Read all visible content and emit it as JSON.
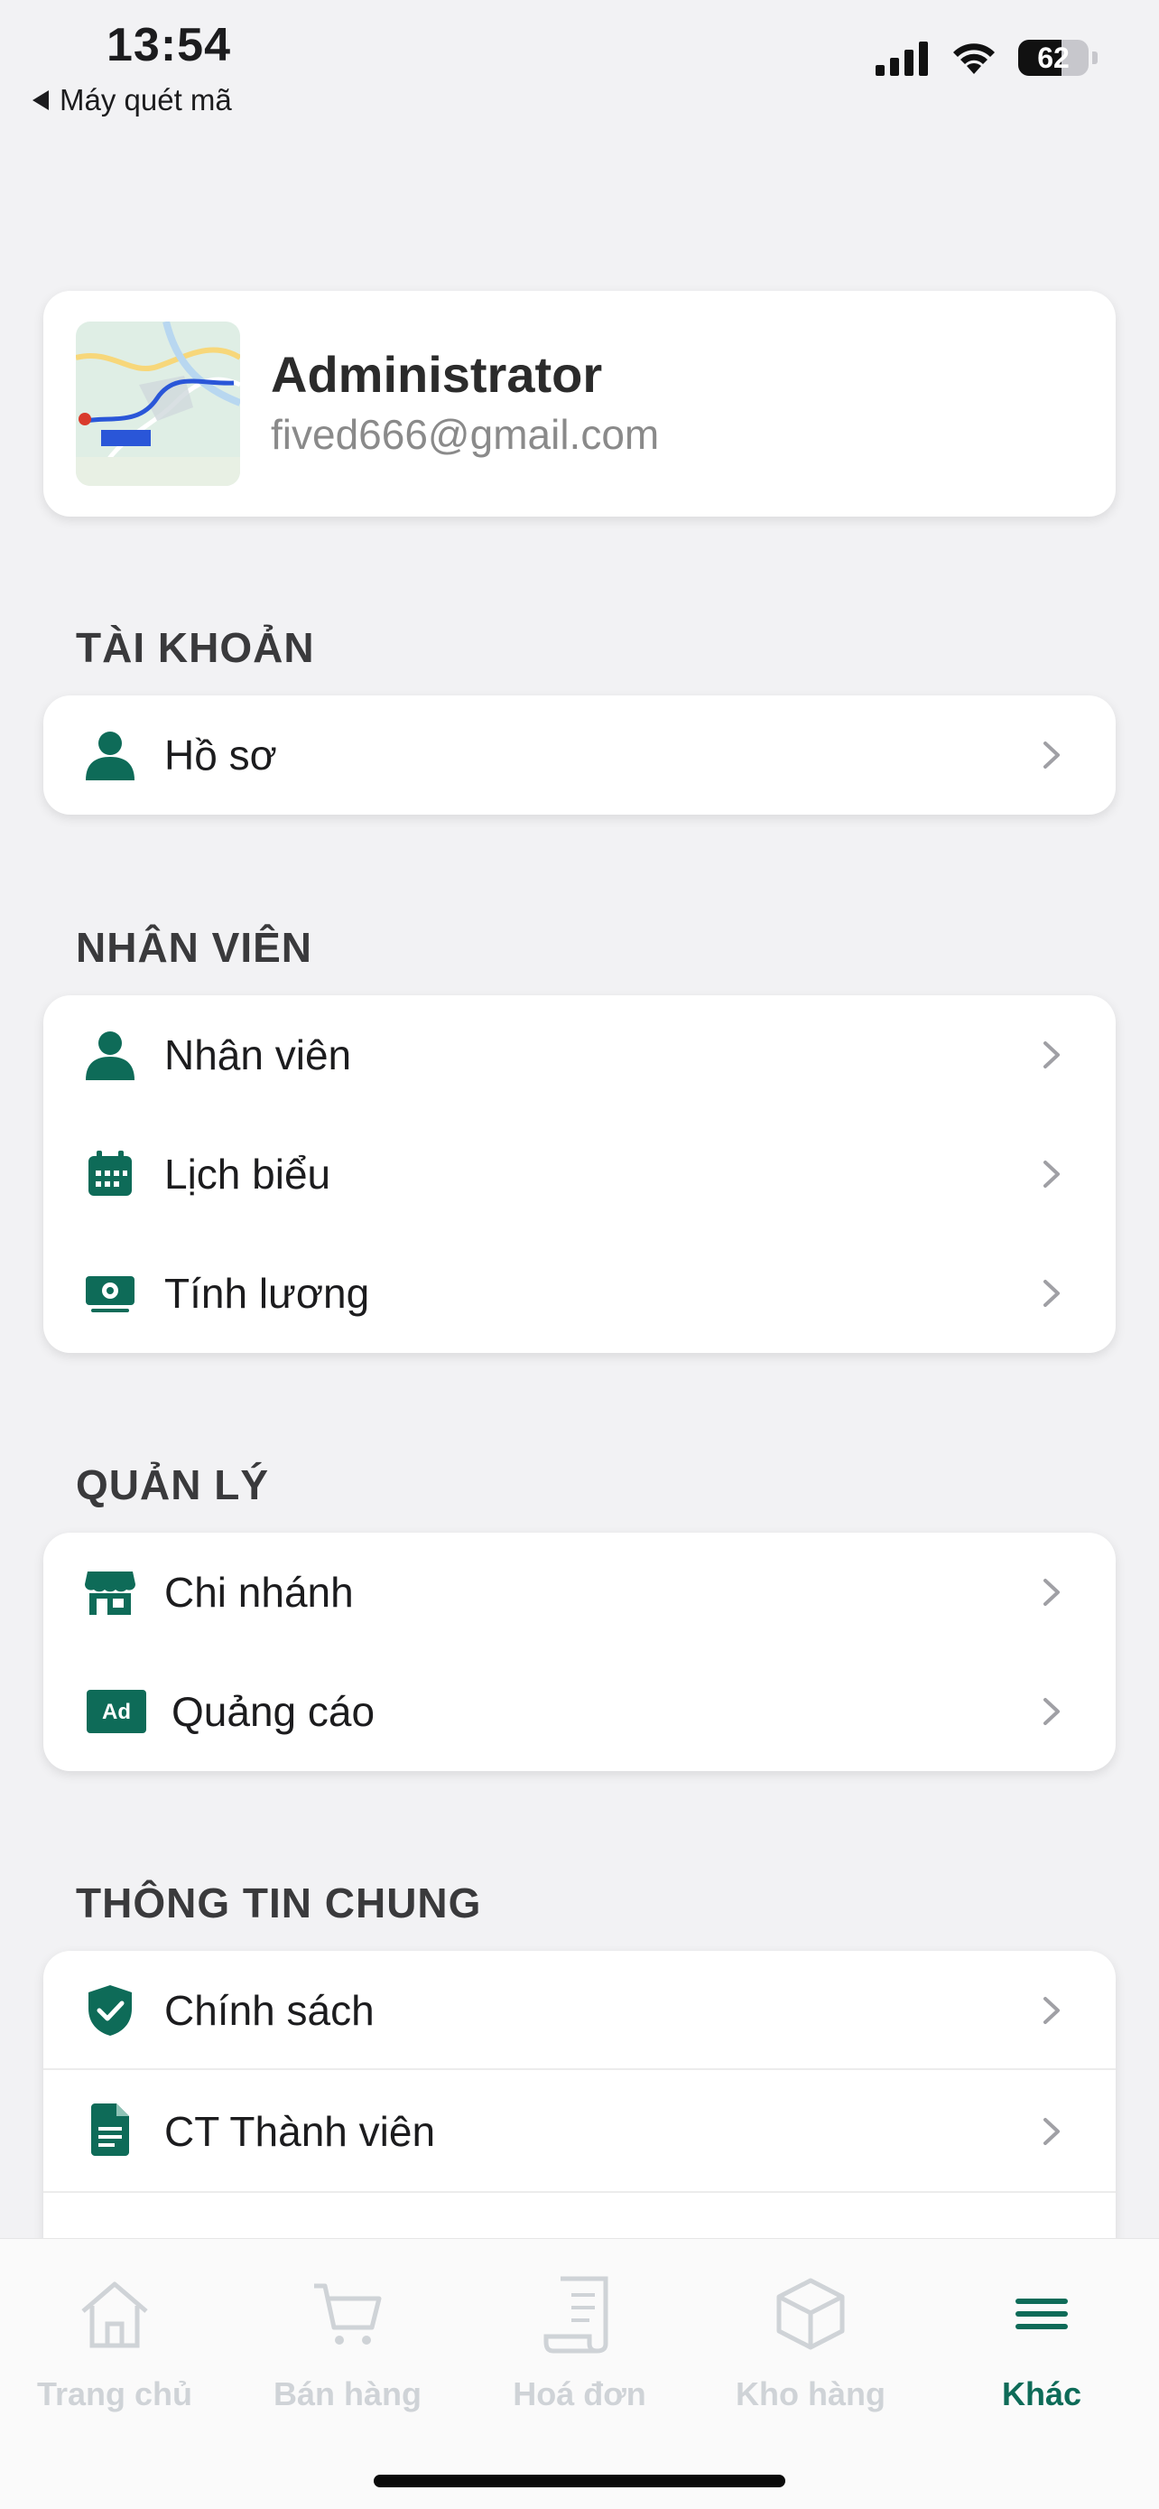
{
  "status_bar": {
    "time": "13:54",
    "back_label": "Máy quét mã",
    "battery_level": "62",
    "battery_fraction": 0.62,
    "icons": [
      "cellular-signal-icon",
      "wifi-icon",
      "battery-icon"
    ]
  },
  "profile": {
    "name": "Administrator",
    "email": "fived666@gmail.com",
    "avatar_icon": "map-thumbnail"
  },
  "sections": {
    "account": {
      "title": "TÀI KHOẢN",
      "items": [
        {
          "label": "Hồ sơ",
          "icon": "person-icon"
        }
      ]
    },
    "staff": {
      "title": "NHÂN VIÊN",
      "items": [
        {
          "label": "Nhân viên",
          "icon": "person-icon"
        },
        {
          "label": "Lịch biểu",
          "icon": "calendar-icon"
        },
        {
          "label": "Tính lương",
          "icon": "money-icon"
        }
      ]
    },
    "management": {
      "title": "QUẢN LÝ",
      "items": [
        {
          "label": "Chi nhánh",
          "icon": "store-icon"
        },
        {
          "label": "Quảng cáo",
          "icon": "ad-icon",
          "badge": "Ad"
        }
      ]
    },
    "general": {
      "title": "THÔNG TIN CHUNG",
      "items": [
        {
          "label": "Chính sách",
          "icon": "shield-check-icon"
        },
        {
          "label": "CT Thành viên",
          "icon": "document-icon"
        }
      ]
    }
  },
  "tab_bar": {
    "tabs": [
      {
        "label": "Trang chủ",
        "icon": "home-icon",
        "active": false
      },
      {
        "label": "Bán hàng",
        "icon": "cart-icon",
        "active": false
      },
      {
        "label": "Hoá đơn",
        "icon": "receipt-icon",
        "active": false
      },
      {
        "label": "Kho hàng",
        "icon": "box-icon",
        "active": false
      },
      {
        "label": "Khác",
        "icon": "menu-icon",
        "active": true
      }
    ]
  },
  "colors": {
    "accent": "#0e6b58",
    "inactive_tab": "#cfd3d7",
    "background": "#f2f2f4",
    "card": "#ffffff",
    "email": "#8a8a8a"
  }
}
